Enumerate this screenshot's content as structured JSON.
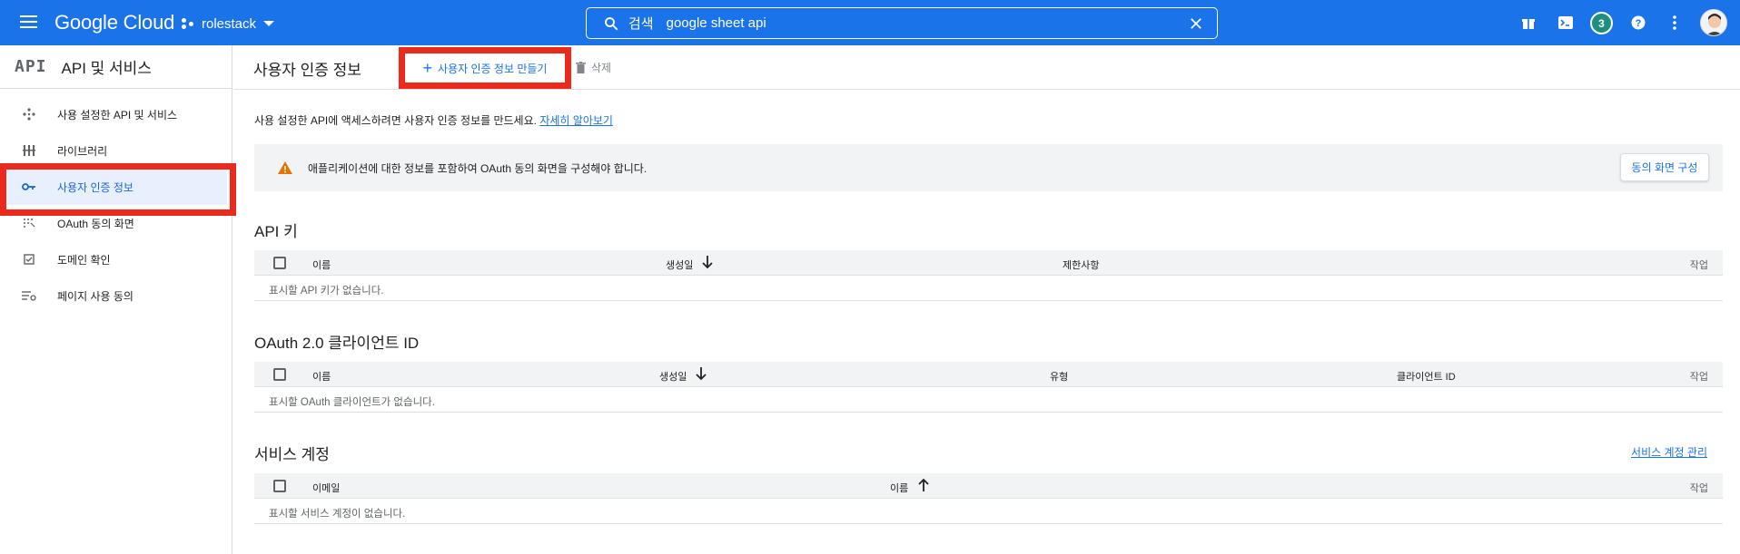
{
  "topbar": {
    "logo": "Google Cloud",
    "project": "rolestack",
    "search_prefix": "검색",
    "search_value": "google sheet api",
    "notification_count": "3",
    "colors": {
      "bar": "#1a73e8",
      "badge": "#1e8e7e"
    }
  },
  "sidebar": {
    "api_logo": "API",
    "title": "API 및 서비스",
    "items": [
      {
        "label": "사용 설정한 API 및 서비스",
        "icon": "move-dots-icon"
      },
      {
        "label": "라이브러리",
        "icon": "library-icon"
      },
      {
        "label": "사용자 인증 정보",
        "icon": "key-icon",
        "active": true
      },
      {
        "label": "OAuth 동의 화면",
        "icon": "consent-grid-icon"
      },
      {
        "label": "도메인 확인",
        "icon": "checkbox-icon"
      },
      {
        "label": "페이지 사용 동의",
        "icon": "settings-list-icon"
      }
    ]
  },
  "main": {
    "title": "사용자 인증 정보",
    "create_label": "사용자 인증 정보 만들기",
    "delete_label": "삭제",
    "intro_text": "사용 설정한 API에 액세스하려면 사용자 인증 정보를 만드세요.",
    "learn_more": "자세히 알아보기",
    "warning_text": "애플리케이션에 대한 정보를 포함하여 OAuth 동의 화면을 구성해야 합니다.",
    "warning_button": "동의 화면 구성",
    "api_keys": {
      "title": "API 키",
      "columns": [
        "이름",
        "생성일",
        "제한사항",
        "작업"
      ],
      "empty": "표시할 API 키가 없습니다."
    },
    "oauth": {
      "title": "OAuth 2.0 클라이언트 ID",
      "columns": [
        "이름",
        "생성일",
        "유형",
        "클라이언트 ID",
        "작업"
      ],
      "empty": "표시할 OAuth 클라이언트가 없습니다."
    },
    "service_accounts": {
      "title": "서비스 계정",
      "manage_link": "서비스 계정 관리",
      "columns": [
        "이메일",
        "이름",
        "작업"
      ],
      "empty": "표시할 서비스 계정이 없습니다."
    }
  }
}
